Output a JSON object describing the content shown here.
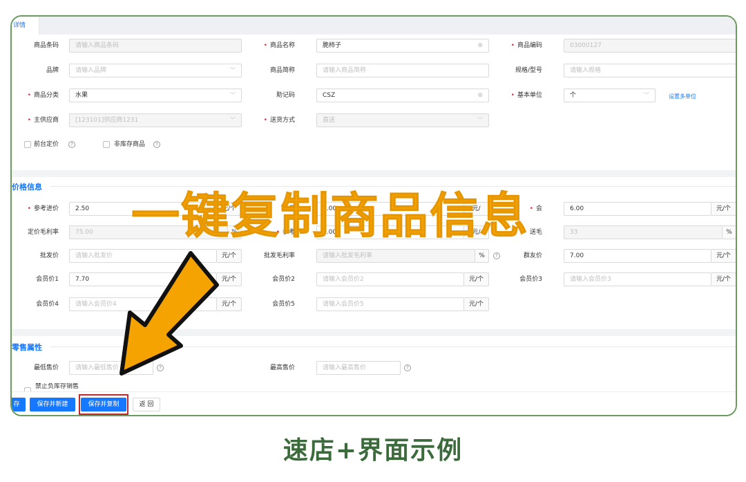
{
  "tab": {
    "label": "详情"
  },
  "basic": {
    "barcode_label": "商品条码",
    "barcode_placeholder": "请输入商品条码",
    "name_label": "商品名称",
    "name_value": "脆柿子",
    "code_label": "商品编码",
    "code_value": "03000127",
    "brand_label": "品牌",
    "brand_placeholder": "请输入品牌",
    "short_label": "商品简称",
    "short_placeholder": "请输入商品简称",
    "spec_label": "规格/型号",
    "spec_placeholder": "请输入规格",
    "category_label": "商品分类",
    "category_value": "水果",
    "mnemonic_label": "助记码",
    "mnemonic_value": "CSZ",
    "unit_label": "基本单位",
    "unit_value": "个",
    "multi_unit_link": "设置多单位",
    "supplier_label": "主供应商",
    "supplier_value": "[123101]供应商1231",
    "delivery_label": "送货方式",
    "delivery_value": "直送",
    "front_price_label": "前台定价",
    "non_stock_label": "非库存商品"
  },
  "price": {
    "section_title": "价格信息",
    "ref_cost_label": "参考进价",
    "ref_cost_value": "2.50",
    "ref_cost_unit": "元/个",
    "mid_top_label": "参",
    "mid_top_value": "8.00",
    "mid_top_unit": "元/",
    "right_top_label": "会",
    "right_top_value": "6.00",
    "right_top_unit": "元/个",
    "margin_label": "定价毛利率",
    "margin_value": "75.00",
    "margin_unit": "%",
    "mid_mid_label": "参考",
    "mid_mid_value": "3.00",
    "mid_mid_unit": "元/",
    "right_mid_label": "送毛",
    "right_mid_value": "33",
    "right_mid_unit": "%",
    "wholesale_label": "批发价",
    "wholesale_placeholder": "请输入批发价",
    "wholesale_unit": "元/个",
    "wholesale_margin_label": "批发毛利率",
    "wholesale_margin_placeholder": "请输入批发毛利率",
    "wholesale_margin_unit": "%",
    "group_label": "群友价",
    "group_value": "7.00",
    "group_unit": "元/个",
    "member1_label": "会员价1",
    "member1_value": "7.70",
    "member1_unit": "元/个",
    "member2_label": "会员价2",
    "member2_placeholder": "请输入会员价2",
    "member2_unit": "元/个",
    "member3_label": "会员价3",
    "member3_placeholder": "请输入会员价3",
    "member3_unit": "元/个",
    "member4_label": "会员价4",
    "member4_placeholder": "请输入会员价4",
    "member4_unit": "元/个",
    "member5_label": "会员价5",
    "member5_placeholder": "请输入会员价5",
    "member5_unit": "元/个"
  },
  "retail": {
    "section_title": "零售属性",
    "min_label": "最低售价",
    "min_placeholder": "请输入最低售价",
    "max_label": "最高售价",
    "max_placeholder": "请输入最高售价",
    "partial_label": "禁止负库存销售"
  },
  "footer": {
    "save_label": "存",
    "save_new_label": "保存并新建",
    "save_copy_label": "保存并复制",
    "back_label": "返 回"
  },
  "overlay": {
    "headline": "一键复制商品信息"
  },
  "caption": {
    "text": "速店+界面示例"
  },
  "colors": {
    "primary": "#1677ff",
    "headline": "#f5a300",
    "caption": "#3c6b3b",
    "frame": "#6a9a5c",
    "highlight": "#c0272d"
  }
}
